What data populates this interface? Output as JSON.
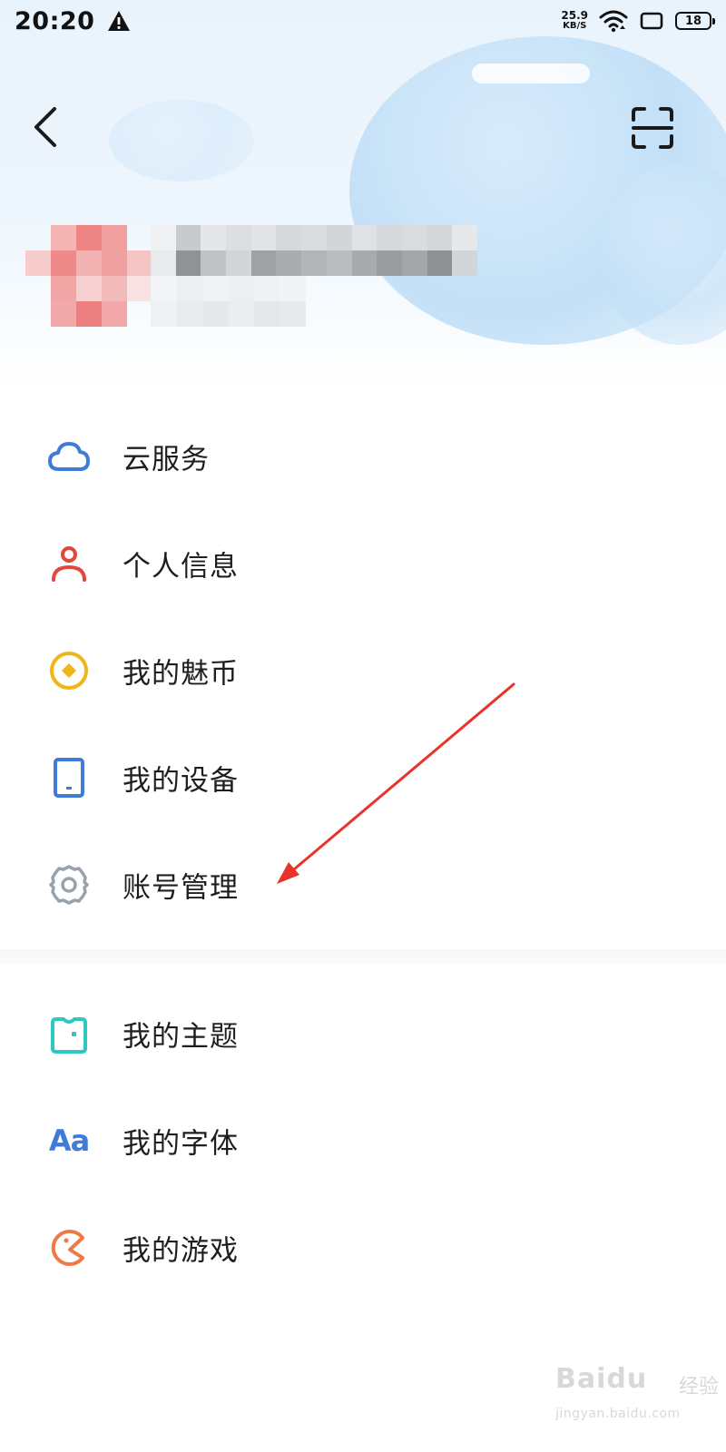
{
  "status_bar": {
    "time": "20:20",
    "net_speed_value": "25.9",
    "net_speed_unit": "KB/S",
    "battery_level": "18"
  },
  "menu_group_1": [
    {
      "label": "云服务",
      "icon": "cloud-icon",
      "color": "#3f7bd9"
    },
    {
      "label": "个人信息",
      "icon": "person-icon",
      "color": "#e2483b"
    },
    {
      "label": "我的魅币",
      "icon": "coin-icon",
      "color": "#f1b519"
    },
    {
      "label": "我的设备",
      "icon": "tablet-icon",
      "color": "#3f7bd9"
    },
    {
      "label": "账号管理",
      "icon": "gear-icon",
      "color": "#9aa3ad"
    }
  ],
  "menu_group_2": [
    {
      "label": "我的主题",
      "icon": "theme-shirt-icon",
      "color": "#2fc8c0"
    },
    {
      "label": "我的字体",
      "icon": "font-aa-icon",
      "icon_text": "Aa",
      "color": "#3f7bd9"
    },
    {
      "label": "我的游戏",
      "icon": "game-pacman-icon",
      "color": "#f07a45"
    }
  ],
  "watermark": {
    "brand": "Baidu",
    "sub": "经验",
    "url": "jingyan.baidu.com"
  },
  "colors": {
    "annotation_arrow": "#e8322a",
    "hero_bg": "#e8f3fc"
  }
}
